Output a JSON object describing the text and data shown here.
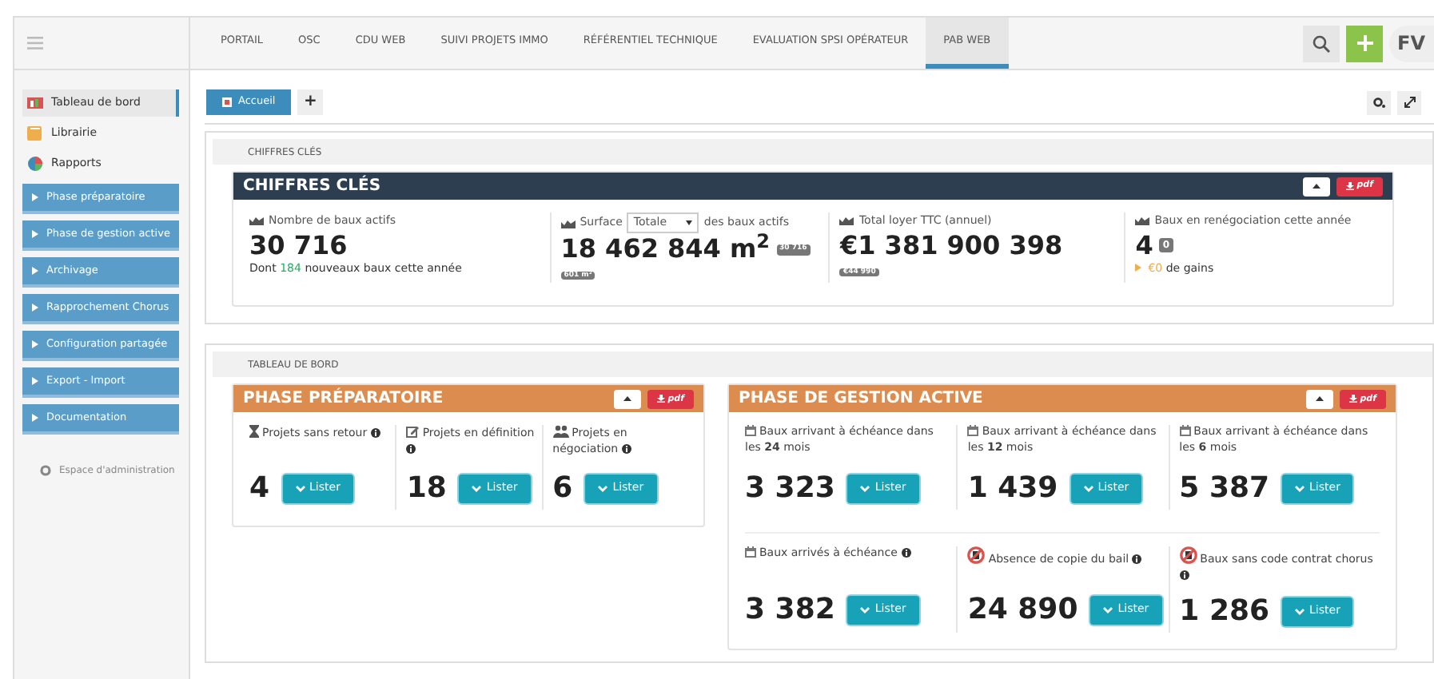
{
  "topnav": {
    "tabs": [
      {
        "label": "PORTAIL",
        "selected": false
      },
      {
        "label": "OSC",
        "selected": false
      },
      {
        "label": "CDU WEB",
        "selected": false
      },
      {
        "label": "SUIVI PROJETS IMMO",
        "selected": false
      },
      {
        "label": "RÉFÉRENTIEL TECHNIQUE",
        "selected": false
      },
      {
        "label": "EVALUATION SPSI OPÉRATEUR",
        "selected": false
      },
      {
        "label": "PAB WEB",
        "selected": true
      }
    ],
    "avatar": "FV"
  },
  "sidebar": {
    "items": [
      {
        "label": "Tableau de bord",
        "kind": "link",
        "selected": true
      },
      {
        "label": "Librairie",
        "kind": "link",
        "selected": false
      },
      {
        "label": "Rapports",
        "kind": "link",
        "selected": false
      },
      {
        "label": "Phase préparatoire",
        "kind": "section",
        "selected": false
      },
      {
        "label": "Phase de gestion active",
        "kind": "section",
        "selected": false
      },
      {
        "label": "Archivage",
        "kind": "section",
        "selected": false
      },
      {
        "label": "Rapprochement Chorus",
        "kind": "section",
        "selected": false
      },
      {
        "label": "Configuration partagée",
        "kind": "section",
        "selected": false
      },
      {
        "label": "Export - Import",
        "kind": "section",
        "selected": false
      },
      {
        "label": "Documentation",
        "kind": "section",
        "selected": false
      }
    ],
    "admin_link": "Espace d'administration"
  },
  "toolbar": {
    "home_button": "Accueil",
    "add_button": "+"
  },
  "key_figures": {
    "section_label": "CHIFFRES CLÉS",
    "panel_title": "CHIFFRES CLÉS",
    "pdf_button": "pdf",
    "kpis": [
      {
        "kind": "plain",
        "label": "Nombre de baux actifs",
        "value": "30 716",
        "note_prefix": "Dont",
        "note_highlight": "184",
        "note_suffix": "nouveaux baux cette année"
      },
      {
        "kind": "select",
        "label": "Surface",
        "select_value": "Totale",
        "label_suffix": "des baux actifs",
        "value": "18 462 844 m$^{2}$",
        "side_badge": "30 716",
        "badge": "601 m²"
      },
      {
        "kind": "plain",
        "label": "Total loyer TTC (annuel)",
        "value": "€1 381 900 398",
        "badge": "€44 990"
      },
      {
        "kind": "gains",
        "label": "Baux en renégociation cette année",
        "value": "4",
        "side_badge": "0",
        "note_highlight": "€0",
        "note_suffix": "de gains"
      }
    ]
  },
  "dashboard": {
    "section_label": "TABLEAU DE BORD",
    "panels": [
      {
        "title": "PHASE PRÉPARATOIRE",
        "pdf_button": "pdf",
        "rows": [
          [
            {
              "kind": "hourglass",
              "label": "Projets sans retour",
              "info": true,
              "value": "4",
              "button": "Lister"
            },
            {
              "kind": "edit",
              "label": "Projets en définition",
              "info": true,
              "value": "18",
              "button": "Lister"
            },
            {
              "kind": "users",
              "label": "Projets en négociation",
              "info": true,
              "value": "6",
              "button": "Lister"
            }
          ]
        ]
      },
      {
        "title": "PHASE DE GESTION ACTIVE",
        "pdf_button": "pdf",
        "rows": [
          [
            {
              "kind": "calendar",
              "label": "Baux arrivant à échéance dans les **24** mois",
              "info": false,
              "value": "3 323",
              "button": "Lister"
            },
            {
              "kind": "calendar",
              "label": "Baux arrivant à échéance dans les **12** mois",
              "info": false,
              "value": "1 439",
              "button": "Lister"
            },
            {
              "kind": "calendar",
              "label": "Baux arrivant à échéance dans les **6** mois",
              "info": false,
              "value": "5 387",
              "button": "Lister"
            }
          ],
          [
            {
              "kind": "calendar",
              "label": "Baux arrivés à échéance",
              "info": true,
              "value": "3 382",
              "button": "Lister"
            },
            {
              "kind": "forbidden",
              "label": "Absence de copie du bail",
              "info": true,
              "value": "24 890",
              "button": "Lister"
            },
            {
              "kind": "forbidden",
              "label": "Baux sans code contrat chorus",
              "info": true,
              "value": "1 286",
              "button": "Lister"
            }
          ]
        ]
      }
    ]
  }
}
